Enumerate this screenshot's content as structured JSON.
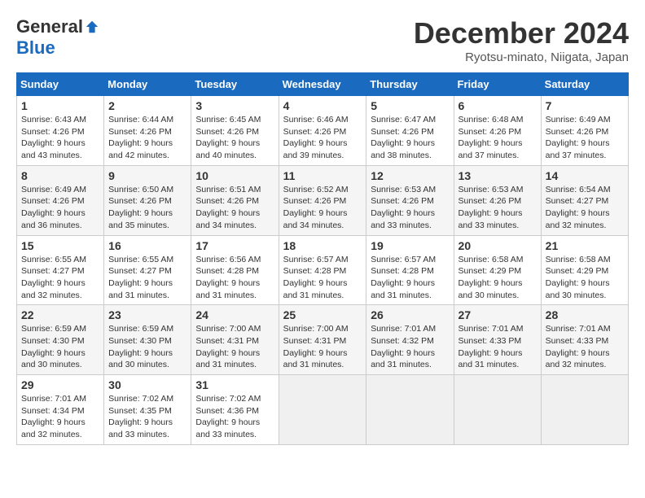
{
  "logo": {
    "general": "General",
    "blue": "Blue"
  },
  "header": {
    "title": "December 2024",
    "subtitle": "Ryotsu-minato, Niigata, Japan"
  },
  "weekdays": [
    "Sunday",
    "Monday",
    "Tuesday",
    "Wednesday",
    "Thursday",
    "Friday",
    "Saturday"
  ],
  "weeks": [
    [
      {
        "day": "1",
        "sunrise": "6:43 AM",
        "sunset": "4:26 PM",
        "daylight": "9 hours and 43 minutes."
      },
      {
        "day": "2",
        "sunrise": "6:44 AM",
        "sunset": "4:26 PM",
        "daylight": "9 hours and 42 minutes."
      },
      {
        "day": "3",
        "sunrise": "6:45 AM",
        "sunset": "4:26 PM",
        "daylight": "9 hours and 40 minutes."
      },
      {
        "day": "4",
        "sunrise": "6:46 AM",
        "sunset": "4:26 PM",
        "daylight": "9 hours and 39 minutes."
      },
      {
        "day": "5",
        "sunrise": "6:47 AM",
        "sunset": "4:26 PM",
        "daylight": "9 hours and 38 minutes."
      },
      {
        "day": "6",
        "sunrise": "6:48 AM",
        "sunset": "4:26 PM",
        "daylight": "9 hours and 37 minutes."
      },
      {
        "day": "7",
        "sunrise": "6:49 AM",
        "sunset": "4:26 PM",
        "daylight": "9 hours and 37 minutes."
      }
    ],
    [
      {
        "day": "8",
        "sunrise": "6:49 AM",
        "sunset": "4:26 PM",
        "daylight": "9 hours and 36 minutes."
      },
      {
        "day": "9",
        "sunrise": "6:50 AM",
        "sunset": "4:26 PM",
        "daylight": "9 hours and 35 minutes."
      },
      {
        "day": "10",
        "sunrise": "6:51 AM",
        "sunset": "4:26 PM",
        "daylight": "9 hours and 34 minutes."
      },
      {
        "day": "11",
        "sunrise": "6:52 AM",
        "sunset": "4:26 PM",
        "daylight": "9 hours and 34 minutes."
      },
      {
        "day": "12",
        "sunrise": "6:53 AM",
        "sunset": "4:26 PM",
        "daylight": "9 hours and 33 minutes."
      },
      {
        "day": "13",
        "sunrise": "6:53 AM",
        "sunset": "4:26 PM",
        "daylight": "9 hours and 33 minutes."
      },
      {
        "day": "14",
        "sunrise": "6:54 AM",
        "sunset": "4:27 PM",
        "daylight": "9 hours and 32 minutes."
      }
    ],
    [
      {
        "day": "15",
        "sunrise": "6:55 AM",
        "sunset": "4:27 PM",
        "daylight": "9 hours and 32 minutes."
      },
      {
        "day": "16",
        "sunrise": "6:55 AM",
        "sunset": "4:27 PM",
        "daylight": "9 hours and 31 minutes."
      },
      {
        "day": "17",
        "sunrise": "6:56 AM",
        "sunset": "4:28 PM",
        "daylight": "9 hours and 31 minutes."
      },
      {
        "day": "18",
        "sunrise": "6:57 AM",
        "sunset": "4:28 PM",
        "daylight": "9 hours and 31 minutes."
      },
      {
        "day": "19",
        "sunrise": "6:57 AM",
        "sunset": "4:28 PM",
        "daylight": "9 hours and 31 minutes."
      },
      {
        "day": "20",
        "sunrise": "6:58 AM",
        "sunset": "4:29 PM",
        "daylight": "9 hours and 30 minutes."
      },
      {
        "day": "21",
        "sunrise": "6:58 AM",
        "sunset": "4:29 PM",
        "daylight": "9 hours and 30 minutes."
      }
    ],
    [
      {
        "day": "22",
        "sunrise": "6:59 AM",
        "sunset": "4:30 PM",
        "daylight": "9 hours and 30 minutes."
      },
      {
        "day": "23",
        "sunrise": "6:59 AM",
        "sunset": "4:30 PM",
        "daylight": "9 hours and 30 minutes."
      },
      {
        "day": "24",
        "sunrise": "7:00 AM",
        "sunset": "4:31 PM",
        "daylight": "9 hours and 31 minutes."
      },
      {
        "day": "25",
        "sunrise": "7:00 AM",
        "sunset": "4:31 PM",
        "daylight": "9 hours and 31 minutes."
      },
      {
        "day": "26",
        "sunrise": "7:01 AM",
        "sunset": "4:32 PM",
        "daylight": "9 hours and 31 minutes."
      },
      {
        "day": "27",
        "sunrise": "7:01 AM",
        "sunset": "4:33 PM",
        "daylight": "9 hours and 31 minutes."
      },
      {
        "day": "28",
        "sunrise": "7:01 AM",
        "sunset": "4:33 PM",
        "daylight": "9 hours and 32 minutes."
      }
    ],
    [
      {
        "day": "29",
        "sunrise": "7:01 AM",
        "sunset": "4:34 PM",
        "daylight": "9 hours and 32 minutes."
      },
      {
        "day": "30",
        "sunrise": "7:02 AM",
        "sunset": "4:35 PM",
        "daylight": "9 hours and 33 minutes."
      },
      {
        "day": "31",
        "sunrise": "7:02 AM",
        "sunset": "4:36 PM",
        "daylight": "9 hours and 33 minutes."
      },
      null,
      null,
      null,
      null
    ]
  ]
}
